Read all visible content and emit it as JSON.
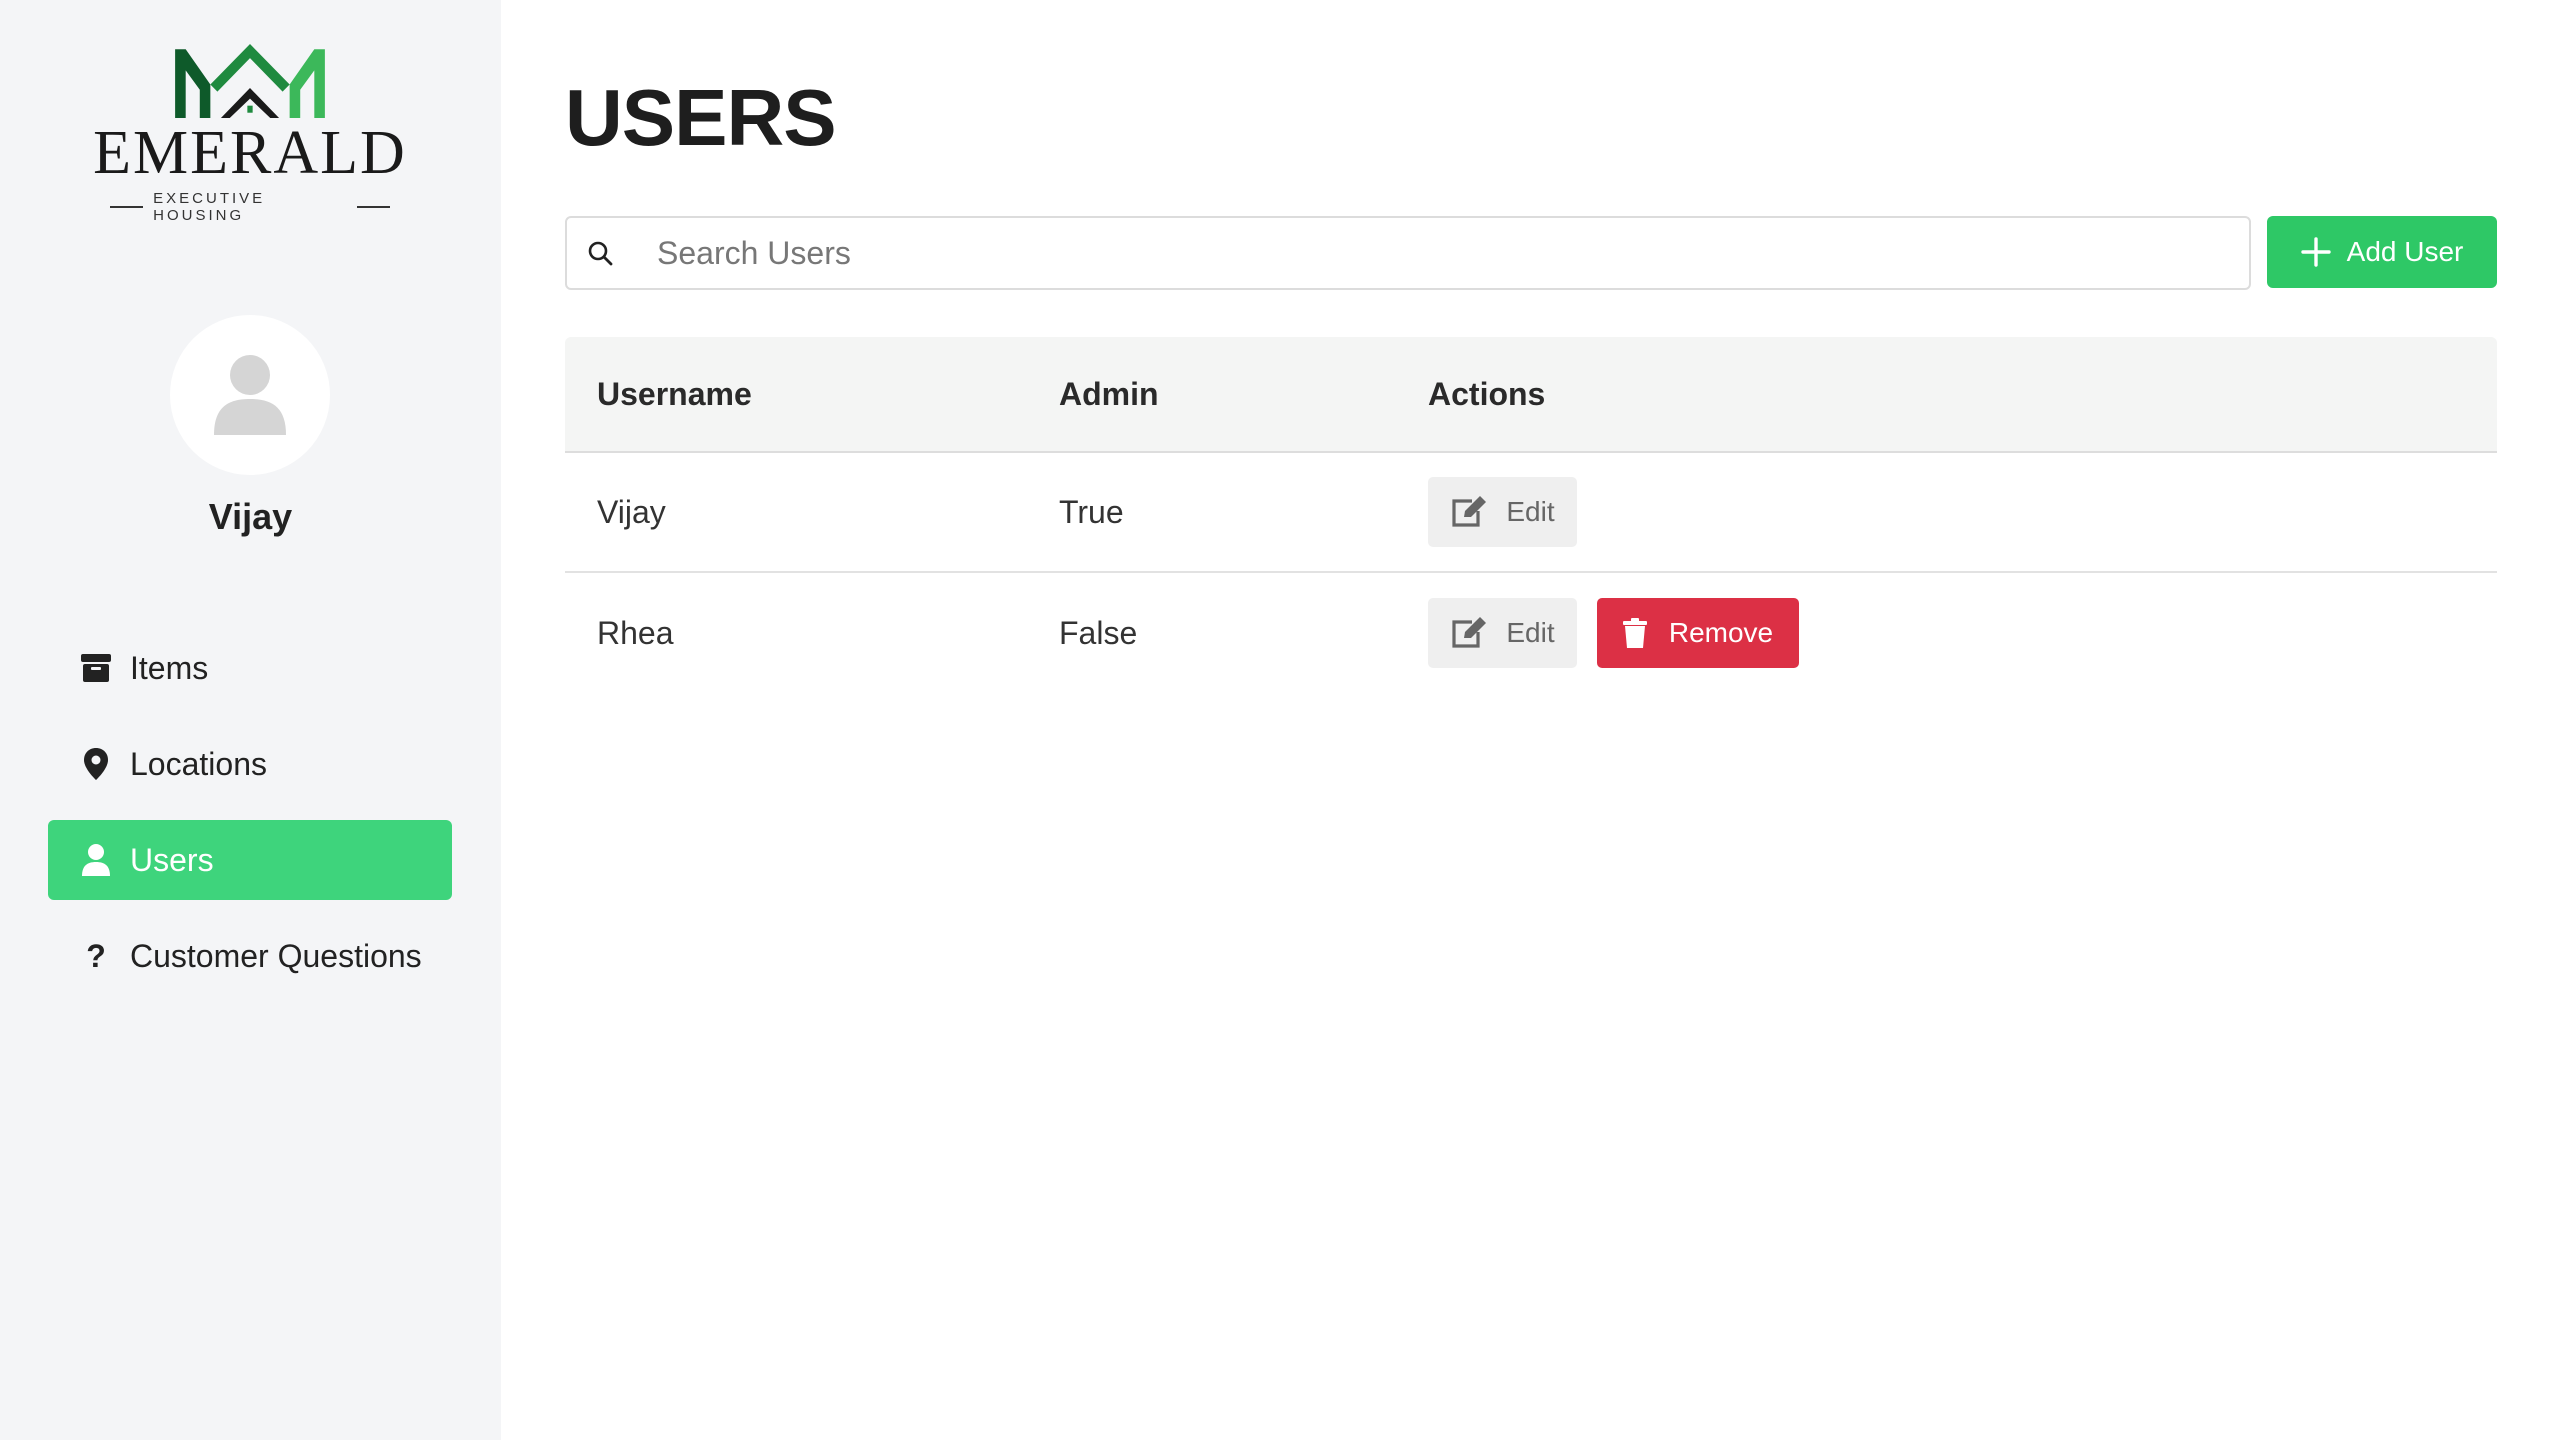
{
  "brand": {
    "name": "EMERALD",
    "tagline": "EXECUTIVE HOUSING",
    "colors": {
      "dark_green": "#0e5a2a",
      "mid_green": "#1f8a3f",
      "light_green": "#3cb85a"
    }
  },
  "profile": {
    "name": "Vijay",
    "avatar_icon": "user-avatar-icon"
  },
  "sidebar": {
    "items": [
      {
        "label": "Items",
        "icon": "box-icon",
        "active": false
      },
      {
        "label": "Locations",
        "icon": "map-pin-icon",
        "active": false
      },
      {
        "label": "Users",
        "icon": "user-icon",
        "active": true
      },
      {
        "label": "Customer Questions",
        "icon": "question-icon",
        "active": false
      }
    ],
    "active_color": "#3ed47c"
  },
  "main": {
    "title": "USERS",
    "search": {
      "placeholder": "Search Users",
      "value": ""
    },
    "add_button": {
      "label": "Add User",
      "icon": "plus-icon",
      "color": "#2ec866"
    },
    "table": {
      "columns": [
        "Username",
        "Admin",
        "Actions"
      ],
      "rows": [
        {
          "username": "Vijay",
          "admin": "True",
          "actions": [
            "Edit"
          ]
        },
        {
          "username": "Rhea",
          "admin": "False",
          "actions": [
            "Edit",
            "Remove"
          ]
        }
      ],
      "edit_label": "Edit",
      "remove_label": "Remove",
      "remove_color": "#dc3045"
    }
  }
}
